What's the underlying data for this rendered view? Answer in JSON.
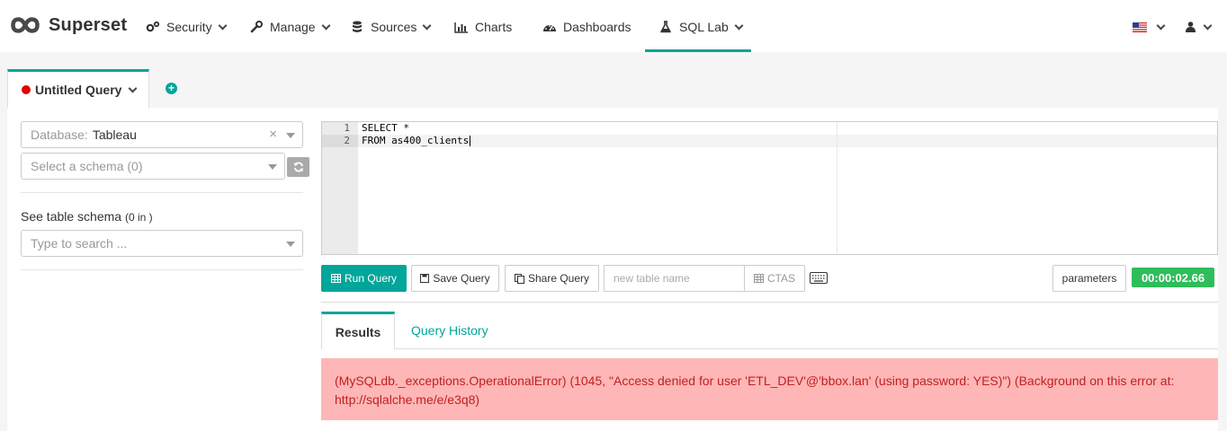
{
  "nav": {
    "brand": "Superset",
    "items": [
      {
        "label": "Security",
        "icon": "cogs-icon",
        "dropdown": true
      },
      {
        "label": "Manage",
        "icon": "wrench-icon",
        "dropdown": true
      },
      {
        "label": "Sources",
        "icon": "database-icon",
        "dropdown": true
      },
      {
        "label": "Charts",
        "icon": "bar-chart-icon",
        "dropdown": false
      },
      {
        "label": "Dashboards",
        "icon": "dashboard-icon",
        "dropdown": false
      },
      {
        "label": "SQL Lab",
        "icon": "flask-icon",
        "dropdown": true,
        "active": true
      }
    ]
  },
  "tabs": {
    "query_tab_label": "Untitled Query"
  },
  "sidebar": {
    "database_prefix": "Database:",
    "database_value": "Tableau",
    "schema_placeholder": "Select a schema (0)",
    "table_schema_label": "See table schema",
    "table_schema_count": "(0 in )",
    "table_search_placeholder": "Type to search ..."
  },
  "editor": {
    "line_numbers": [
      "1",
      "2"
    ],
    "lines": [
      "SELECT *",
      "FROM as400_clients"
    ]
  },
  "toolbar": {
    "run_label": "Run Query",
    "save_label": "Save Query",
    "share_label": "Share Query",
    "table_name_placeholder": "new table name",
    "ctas_label": "CTAS",
    "parameters_label": "parameters",
    "timer": "00:00:02.66"
  },
  "results": {
    "results_tab": "Results",
    "history_tab": "Query History",
    "error_message": "(MySQLdb._exceptions.OperationalError) (1045, \"Access denied for user 'ETL_DEV'@'bbox.lan' (using password: YES)\") (Background on this error at: http://sqlalche.me/e/e3q8)"
  },
  "colors": {
    "accent": "#00a699",
    "timer_bg": "#2fbd5b",
    "error_bg": "#ffb6b6",
    "error_text": "#c22020"
  }
}
